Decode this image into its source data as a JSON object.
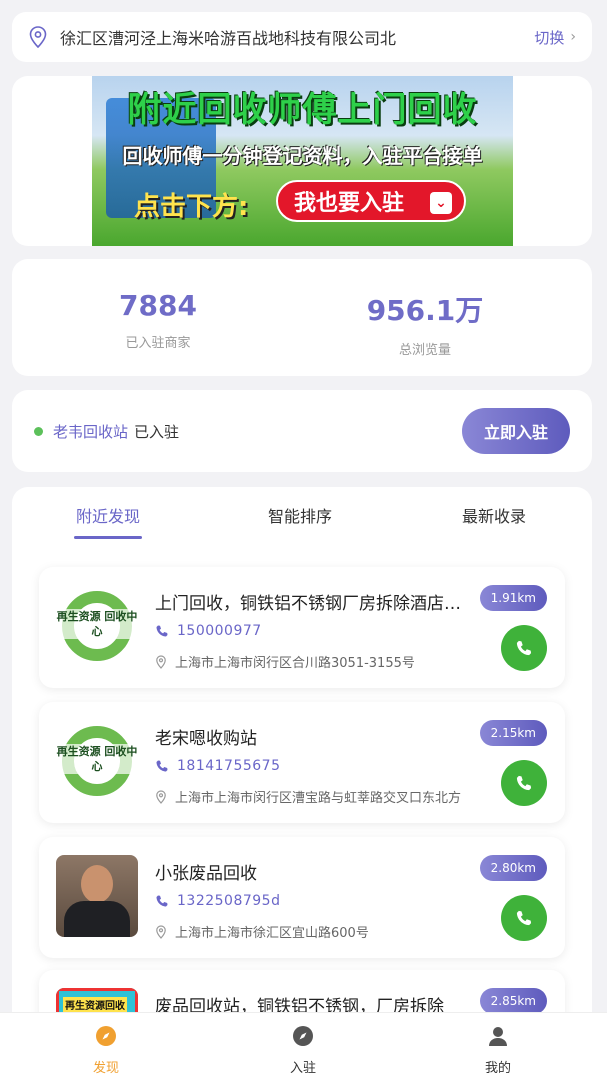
{
  "location": {
    "address": "徐汇区漕河泾上海米哈游百战地科技有限公司北",
    "switch_label": "切换"
  },
  "banner": {
    "line1": "附近回收师傅上门回收",
    "line2": "回收师傅一分钟登记资料，入驻平台接单",
    "line3": "点击下方:",
    "button_label": "我也要入驻"
  },
  "stats": {
    "merchants_value": "7884",
    "merchants_label": "已入驻商家",
    "views_value": "956.1万",
    "views_label": "总浏览量"
  },
  "join": {
    "merchant_name": "老韦回收站",
    "suffix": "已入驻",
    "button_label": "立即入驻"
  },
  "tabs": [
    {
      "label": "附近发现",
      "active": true
    },
    {
      "label": "智能排序",
      "active": false
    },
    {
      "label": "最新收录",
      "active": false
    }
  ],
  "listings": [
    {
      "thumb_type": "recycle",
      "thumb_text": "再生资源 回收中心",
      "title": "上门回收，铜铁铝不锈钢厂房拆除酒店设备",
      "phone": "15‌‌‌0000977",
      "address": "上海市上海市闵行区合川路3051-3155号",
      "distance": "1.91km"
    },
    {
      "thumb_type": "recycle",
      "thumb_text": "再生资源 回收中心",
      "title": "老宋嗯收购站",
      "phone": "1814‌1755675",
      "address": "上海市上海市闵行区漕宝路与虹莘路交叉口东北方",
      "distance": "2.15km"
    },
    {
      "thumb_type": "person",
      "thumb_text": "",
      "title": "小张废品回收",
      "phone": "13‌‌22508795d",
      "address": "上海市上海市徐汇区宜山路600号",
      "distance": "2.80km"
    },
    {
      "thumb_type": "banner",
      "thumb_text": "再生资源回收",
      "title": "废品回收站，铜铁铝不锈钢，厂房拆除",
      "phone": "",
      "address": "",
      "distance": "2.85km"
    }
  ],
  "bottom_nav": [
    {
      "label": "发现",
      "icon": "compass-icon",
      "active": true
    },
    {
      "label": "入驻",
      "icon": "compass-icon",
      "active": false
    },
    {
      "label": "我的",
      "icon": "user-icon",
      "active": false
    }
  ],
  "colors": {
    "accent": "#6a66c8",
    "call_green": "#3fb23a",
    "nav_active": "#f0a030"
  }
}
